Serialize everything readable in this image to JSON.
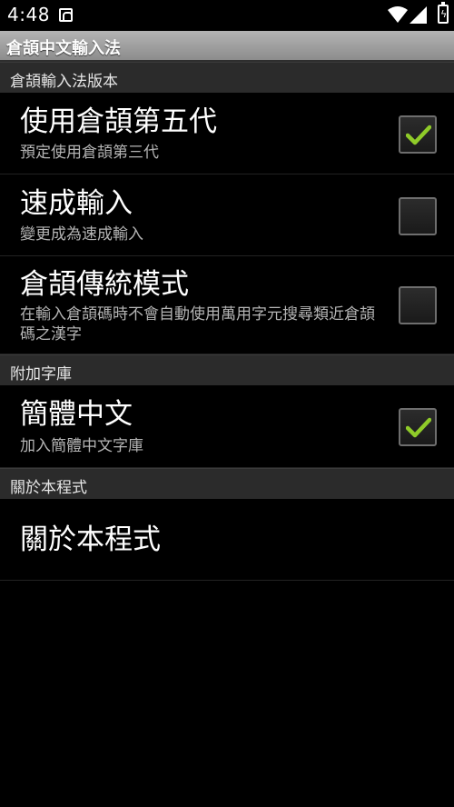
{
  "status_bar": {
    "time": "4:48"
  },
  "title_bar": {
    "title": "倉頡中文輸入法"
  },
  "sections": {
    "version": {
      "header": "倉頡輸入法版本"
    },
    "dictionary": {
      "header": "附加字庫"
    },
    "about": {
      "header": "關於本程式"
    }
  },
  "prefs": {
    "cangjie5": {
      "title": "使用倉頡第五代",
      "summary": "預定使用倉頡第三代",
      "checked": true
    },
    "quick": {
      "title": "速成輸入",
      "summary": "變更成為速成輸入",
      "checked": false
    },
    "traditional": {
      "title": "倉頡傳統模式",
      "summary": "在輸入倉頡碼時不會自動使用萬用字元搜尋類近倉頡碼之漢字",
      "checked": false
    },
    "simplified": {
      "title": "簡體中文",
      "summary": "加入簡體中文字庫",
      "checked": true
    },
    "about": {
      "title": "關於本程式"
    }
  },
  "colors": {
    "check_green": "#8fcb29",
    "section_bg": "#2b2b2b",
    "title_bar": "#a0a0a0"
  },
  "icons": [
    "notification-icon",
    "wifi-icon",
    "signal-icon",
    "battery-icon",
    "checkmark-icon"
  ]
}
